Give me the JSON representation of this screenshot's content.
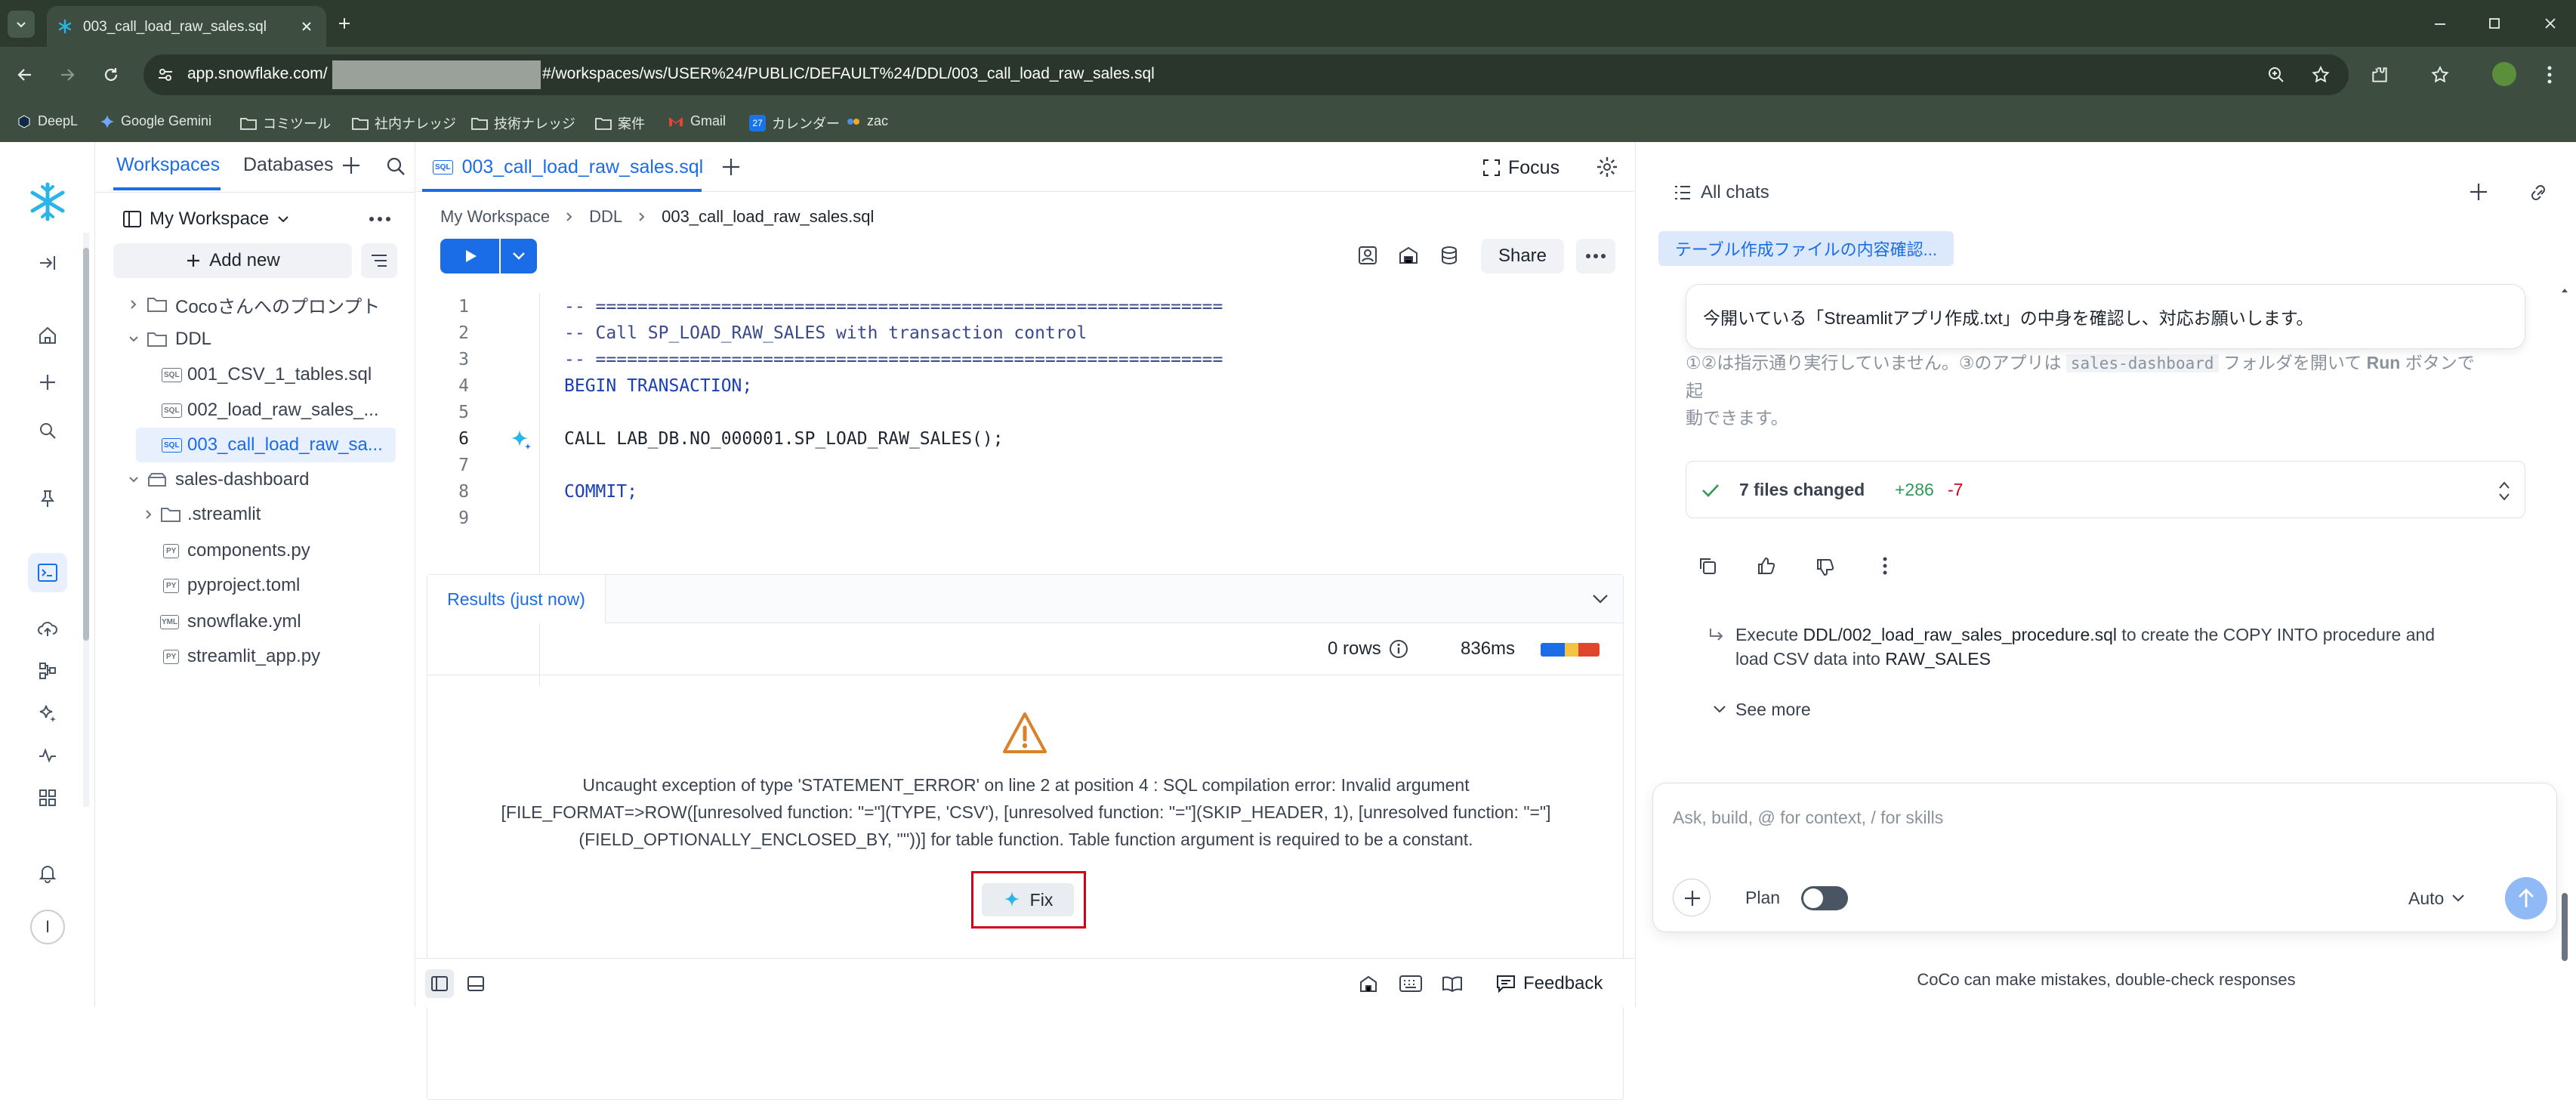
{
  "browser": {
    "tab_title": "003_call_load_raw_sales.sql",
    "url_host": "app.snowflake.com/",
    "url_path": "#/workspaces/ws/USER%24/PUBLIC/DEFAULT%24/DDL/003_call_load_raw_sales.sql",
    "bookmarks": [
      "DeepL",
      "Google Gemini",
      "コミツール",
      "社内ナレッジ",
      "技術ナレッジ",
      "案件",
      "Gmail",
      "カレンダー",
      "zac"
    ],
    "calendar_badge": "27"
  },
  "explorer": {
    "tabs": [
      "Workspaces",
      "Databases"
    ],
    "workspace_label": "My Workspace",
    "add_new_label": "Add new",
    "tree": [
      {
        "label": "Cocoさんへのプロンプト",
        "type": "folder"
      },
      {
        "label": "DDL",
        "type": "folder"
      },
      {
        "label": "001_CSV_1_tables.sql",
        "type": "sql"
      },
      {
        "label": "002_load_raw_sales_...",
        "type": "sql"
      },
      {
        "label": "003_call_load_raw_sa...",
        "type": "sql"
      },
      {
        "label": "sales-dashboard",
        "type": "repo"
      },
      {
        "label": ".streamlit",
        "type": "folder"
      },
      {
        "label": "components.py",
        "type": "py"
      },
      {
        "label": "pyproject.toml",
        "type": "py"
      },
      {
        "label": "snowflake.yml",
        "type": "yml"
      },
      {
        "label": "streamlit_app.py",
        "type": "py"
      }
    ],
    "badges": {
      "sql": "SQL",
      "py": "PY",
      "yml": "YML"
    }
  },
  "editor": {
    "tab_title": "003_call_load_raw_sales.sql",
    "focus_label": "Focus",
    "breadcrumb": [
      "My Workspace",
      "DDL",
      "003_call_load_raw_sales.sql"
    ],
    "share_label": "Share",
    "lines": [
      "-- ============================================================",
      "-- Call SP_LOAD_RAW_SALES with transaction control",
      "-- ============================================================",
      "BEGIN TRANSACTION;",
      "",
      "CALL LAB_DB.NO_000001.SP_LOAD_RAW_SALES();",
      "",
      "COMMIT;",
      ""
    ],
    "line_numbers": [
      "1",
      "2",
      "3",
      "4",
      "5",
      "6",
      "7",
      "8",
      "9"
    ]
  },
  "results": {
    "tab_label": "Results (just now)",
    "rows_label": "0 rows",
    "duration": "836ms",
    "error_lines": [
      "Uncaught exception of type 'STATEMENT_ERROR' on line 2 at position 4 : SQL compilation error: Invalid argument",
      "[FILE_FORMAT=>ROW([unresolved function: \"=\"](TYPE, 'CSV'), [unresolved function: \"=\"](SKIP_HEADER, 1), [unresolved function: \"=\"]",
      "(FIELD_OPTIONALLY_ENCLOSED_BY, '\"'))] for table function. Table function argument is required to be a constant."
    ],
    "fix_label": "Fix"
  },
  "footer": {
    "feedback_label": "Feedback"
  },
  "chat": {
    "all_chats_label": "All chats",
    "chat_title": "テーブル作成ファイルの内容確認...",
    "user_message": "今開いている「Streamlitアプリ作成.txt」の中身を確認し、対応お願いします。",
    "faded_text_1": "①②は指示通り実行していません。③のアプリは",
    "faded_code": "sales-dashboard",
    "faded_text_2": "フォルダを開いて",
    "faded_run": "Run",
    "faded_text_3": "ボタンで起",
    "faded_text_4": "動できます。",
    "files_changed": "7 files changed",
    "additions": "+286",
    "deletions": "-7",
    "suggestion_pre": "Execute ",
    "suggestion_file": "DDL/002_load_raw_sales_procedure.sql",
    "suggestion_mid": " to create the COPY INTO procedure and",
    "suggestion_line2_pre": "load CSV data into ",
    "suggestion_table": "RAW_SALES",
    "see_more": "See more",
    "input_placeholder": "Ask, build, @ for context, / for skills",
    "plan_label": "Plan",
    "model_label": "Auto",
    "disclaimer": "CoCo can make mistakes, double-check responses"
  },
  "colors": {
    "accent": "#1a6ce7",
    "snowflake": "#29b5e8",
    "error_box": "#d0021b",
    "chrome": "#3d4e40"
  }
}
